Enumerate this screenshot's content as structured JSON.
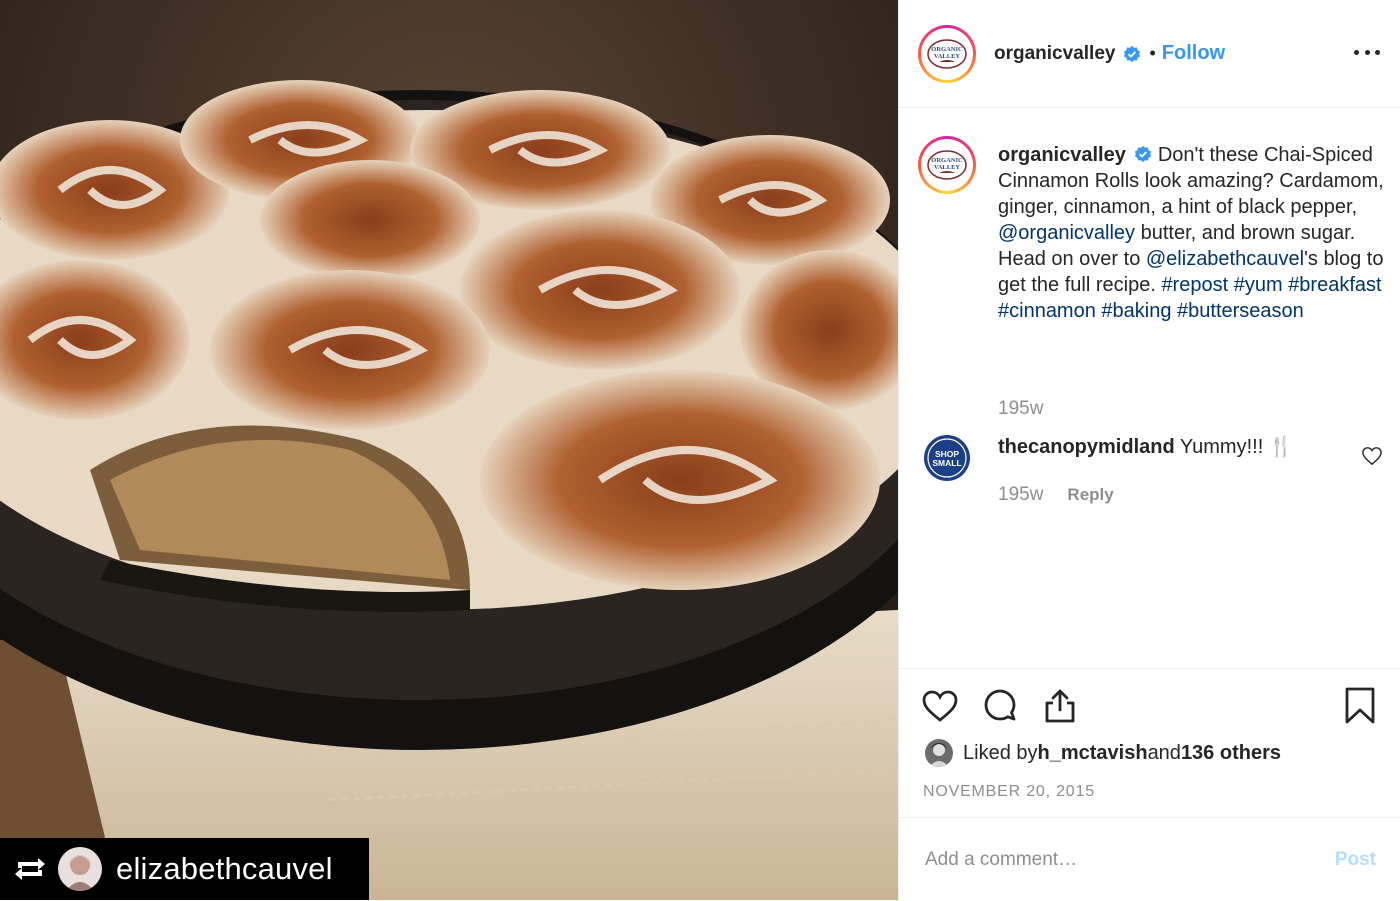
{
  "photo": {
    "repost_icon": "repost-icon",
    "repost_username": "elizabethcauvel"
  },
  "header": {
    "username": "organicvalley",
    "verified_icon": "verified-badge-icon",
    "separator": "•",
    "follow_label": "Follow",
    "more_icon": "more-options-icon",
    "avatar_text": "ORGANIC VALLEY"
  },
  "caption": {
    "username": "organicvalley",
    "text_1": "Don't these Chai-Spiced Cinnamon Rolls look amazing? Cardamom, ginger, cinnamon, a hint of black pepper, ",
    "mention_1": "@organicvalley",
    "text_2": " butter, and brown sugar. Head on over to ",
    "mention_2": "@elizabethcauvel",
    "text_3": "'s blog to get the full recipe. ",
    "hashtags": [
      "#repost",
      "#yum",
      "#breakfast",
      "#cinnamon",
      "#baking",
      "#butterseason"
    ],
    "time": "195w"
  },
  "comment": {
    "username": "thecanopymidland",
    "text": "Yummy!!! 🍴",
    "avatar_text_1": "SHOP",
    "avatar_text_2": "SMALL",
    "time": "195w",
    "reply_label": "Reply"
  },
  "actions": {
    "like_icon": "heart-icon",
    "comment_icon": "comment-icon",
    "share_icon": "share-icon",
    "save_icon": "bookmark-icon",
    "liked_by_prefix": "Liked by ",
    "liked_by_user": "h_mctavish",
    "liked_by_middle": " and ",
    "liked_by_others": "136 others",
    "date": "NOVEMBER 20, 2015"
  },
  "comment_box": {
    "placeholder": "Add a comment…",
    "post_label": "Post"
  },
  "colors": {
    "accent": "#3897f0",
    "link": "#003569",
    "muted": "#8e8e8e",
    "post_disabled": "#b2dffc"
  }
}
